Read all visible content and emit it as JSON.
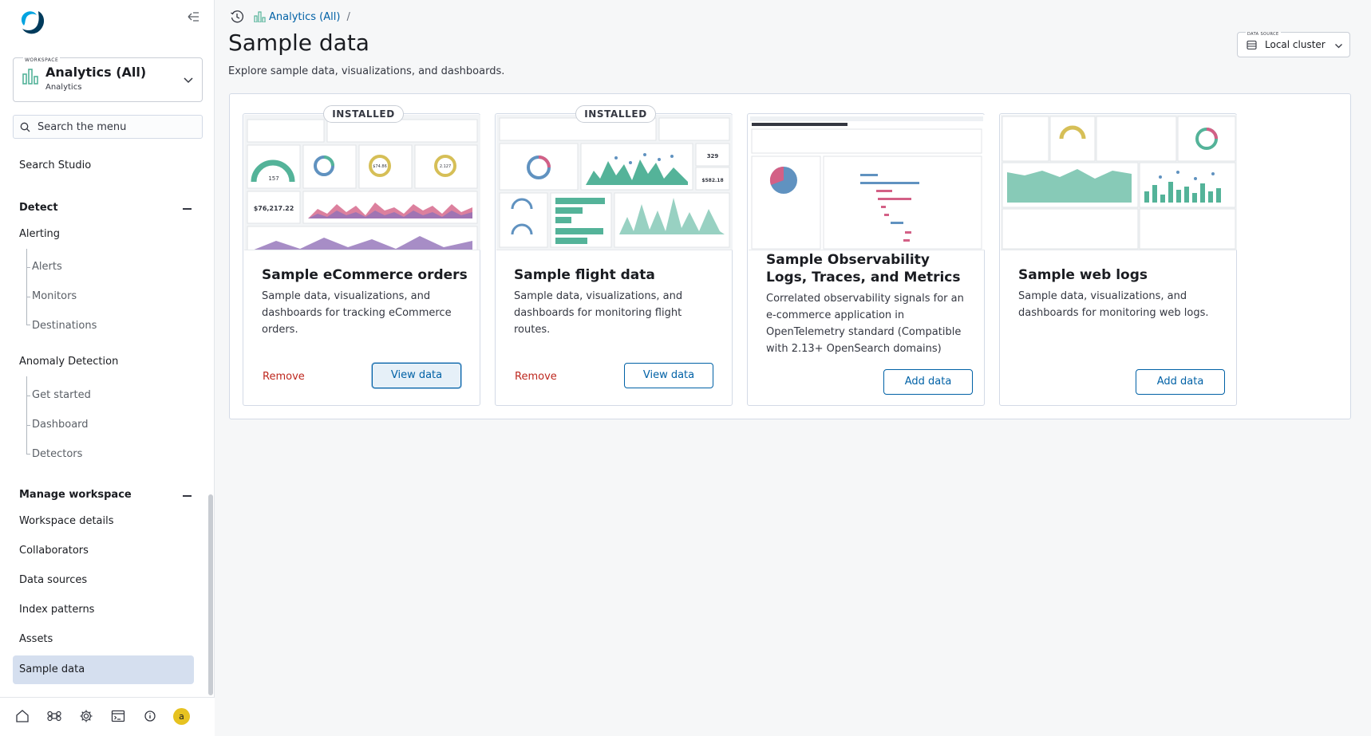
{
  "sidebar": {
    "workspace": {
      "tag": "WORKSPACE",
      "name": "Analytics (All)",
      "sub": "Analytics"
    },
    "search": {
      "placeholder": "Search the menu"
    },
    "search_studio": "Search Studio",
    "detect": {
      "title": "Detect",
      "alerting": "Alerting",
      "alerting_items": [
        "Alerts",
        "Monitors",
        "Destinations"
      ],
      "anomaly": "Anomaly Detection",
      "anomaly_items": [
        "Get started",
        "Dashboard",
        "Detectors"
      ]
    },
    "manage": {
      "title": "Manage workspace",
      "items": [
        "Workspace details",
        "Collaborators",
        "Data sources",
        "Index patterns",
        "Assets",
        "Sample data"
      ]
    },
    "bottom_icons": [
      "home-icon",
      "apps-icon",
      "settings-icon",
      "console-icon",
      "help-icon"
    ],
    "avatar_letter": "a"
  },
  "header": {
    "breadcrumb": "Analytics (All)",
    "separator": "/",
    "title": "Sample data",
    "subtitle": "Explore sample data, visualizations, and dashboards."
  },
  "data_source": {
    "tag": "DATA SOURCE",
    "label": "Local cluster"
  },
  "cards": [
    {
      "badge": "INSTALLED",
      "title": "Sample eCommerce orders",
      "description": "Sample data, visualizations, and dashboards for tracking eCommerce orders.",
      "remove": "Remove",
      "action": "View data",
      "thumb_values": {
        "gauge": "157",
        "donut2": "$74.86",
        "donut3": "2.127",
        "metric": "$76,217.22"
      }
    },
    {
      "badge": "INSTALLED",
      "title": "Sample flight data",
      "description": "Sample data, visualizations, and dashboards for monitoring flight routes.",
      "remove": "Remove",
      "action": "View data",
      "thumb_values": {
        "metric1": "329",
        "metric2": "$582.18"
      }
    },
    {
      "title": "Sample Observability Logs, Traces, and Metrics",
      "description": "Correlated observability signals for an e-commerce application in OpenTelemetry standard (Compatible with 2.13+ OpenSearch domains)",
      "action": "Add data"
    },
    {
      "title": "Sample web logs",
      "description": "Sample data, visualizations, and dashboards for monitoring web logs.",
      "action": "Add data"
    }
  ],
  "colors": {
    "link": "#0061a6",
    "danger": "#bd271e",
    "active_nav": "#d5dfef",
    "avatar": "#e6c220"
  }
}
